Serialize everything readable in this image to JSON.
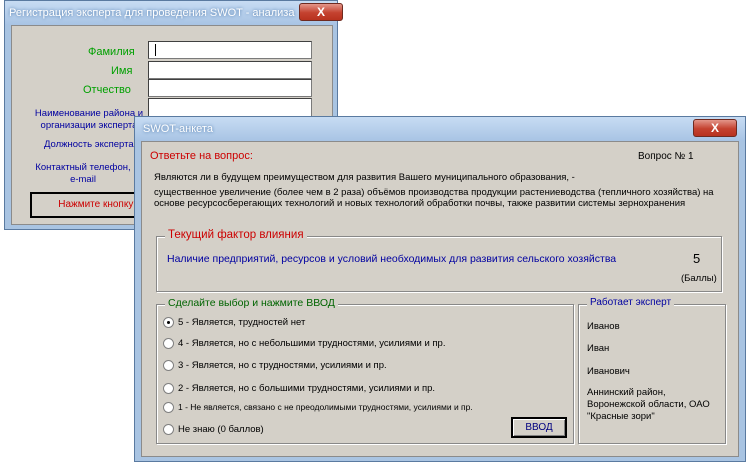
{
  "reg_window": {
    "title": "Регистрация эксперта для проведения SWOT - анализа",
    "close": "X",
    "labels": {
      "surname": "Фамилия",
      "name": "Имя",
      "patronymic": "Отчество",
      "district": "Наименование района и организации эксперта",
      "position": "Должность эксперта",
      "phone": "Контактный телефон, e-mail"
    },
    "button": "Нажмите кнопку тол"
  },
  "swot_window": {
    "title": "SWOT-анкета",
    "close": "X",
    "answer_prompt": "Ответьте на вопрос:",
    "question_number": "Вопрос №  1",
    "question_text_1": "Являются ли в будущем преимуществом для развития Вашего муниципального образования, -",
    "question_text_2": "существенное увеличение (более чем в 2 раза) объёмов производства продукции растениеводства (тепличного хозяйства) на основе ресурсосберегающих технологий и новых технологий обработки почвы,  также развитии системы зернохранения",
    "factor_title": "Текущий фактор влияния",
    "factor_text": "Наличие предприятий, ресурсов и условий  необходимых для развития сельского хозяйства",
    "factor_score": "5",
    "factor_units": "(Баллы)",
    "choice_title": "Сделайте выбор и нажмите ВВОД",
    "options": [
      "5 - Является, трудностей нет",
      "4 - Является, но с небольшими трудностями, усилиями и пр.",
      "3 - Является, но с трудностями, усилиями и пр.",
      "2 - Является, но с большими трудностями, усилиями и пр.",
      "1 - Не является, связано с не преодолимыми трудностями, усилиями и пр.",
      "Не знаю (0 баллов)"
    ],
    "selected_option": 0,
    "enter_button": "ВВОД",
    "expert_title": "Работает эксперт",
    "expert_surname": "Иванов",
    "expert_name": "Иван",
    "expert_patronymic": "Иванович",
    "expert_org": "Аннинский район, Воронежской области, ОАО \"Красные зори\""
  },
  "colors": {
    "title_red": "#cc0000",
    "label_green": "#00a000",
    "label_blue": "#0000a0",
    "close_red": "#c4412f",
    "client_gray": "#d4d0c8"
  }
}
